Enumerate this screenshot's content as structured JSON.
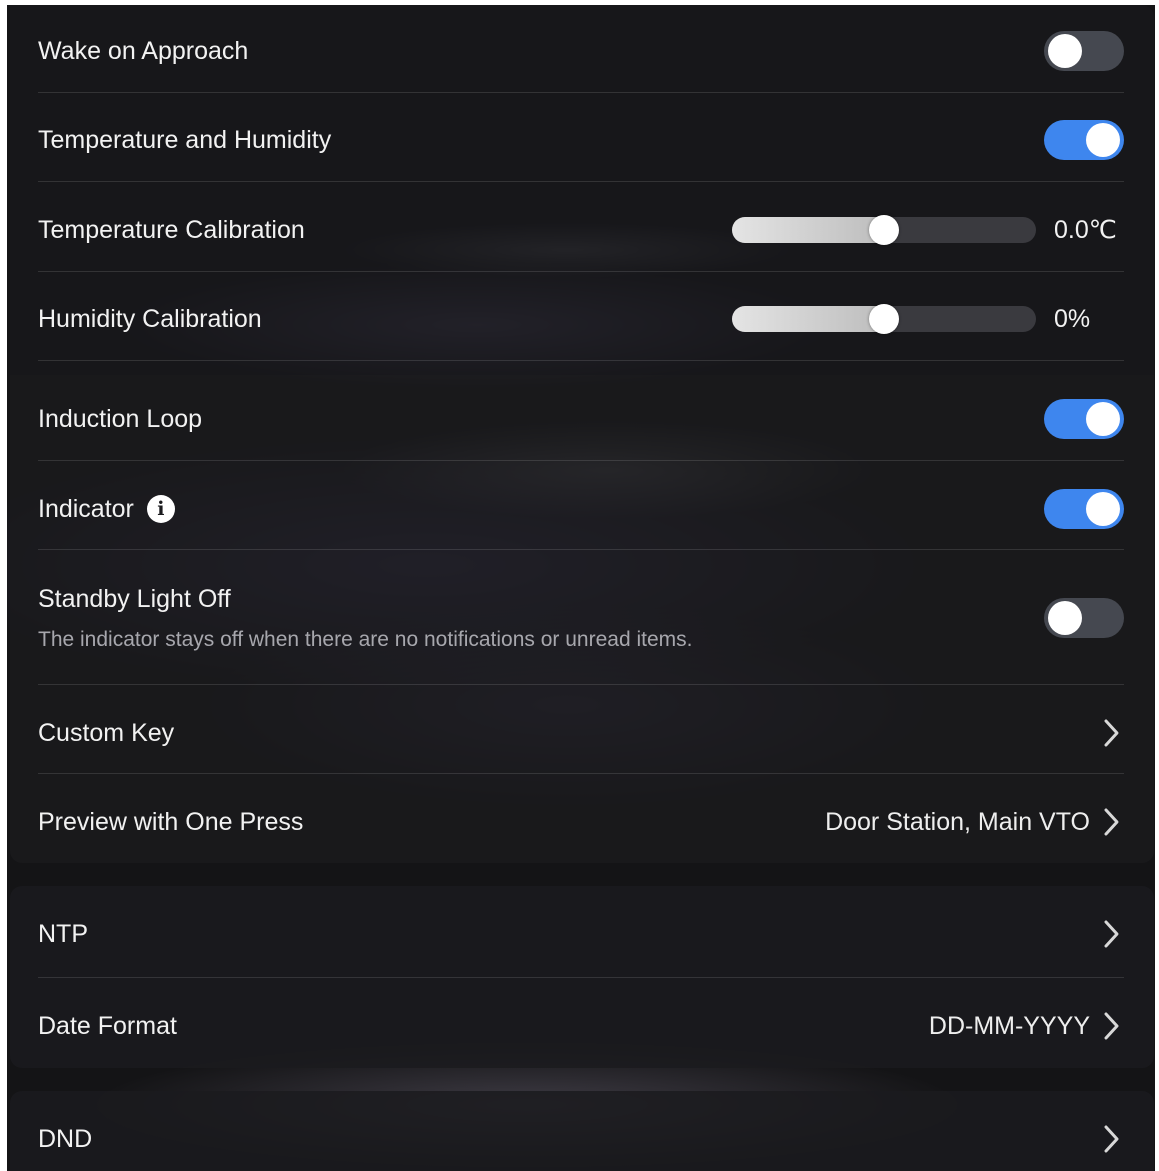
{
  "colors": {
    "accent": "#3e86ee",
    "toggle_off": "#454850",
    "background": "#141416"
  },
  "settings": {
    "wake_on_approach": {
      "label": "Wake on Approach",
      "enabled": false
    },
    "temp_humidity": {
      "label": "Temperature and Humidity",
      "enabled": true
    },
    "temp_calibration": {
      "label": "Temperature Calibration",
      "value": "0.0℃",
      "level": 0.5
    },
    "humidity_calibration": {
      "label": "Humidity Calibration",
      "value": "0%",
      "level": 0.5
    },
    "induction_loop": {
      "label": "Induction Loop",
      "enabled": true
    },
    "indicator": {
      "label": "Indicator",
      "enabled": true,
      "icon": "info-icon"
    },
    "standby_light_off": {
      "label": "Standby Light Off",
      "description": "The indicator stays off when there are no notifications or unread items.",
      "enabled": false
    },
    "custom_key": {
      "label": "Custom Key",
      "icon": "chevron-right-icon"
    },
    "preview_one_press": {
      "label": "Preview with One Press",
      "value": "Door Station, Main VTO",
      "icon": "chevron-right-icon"
    },
    "ntp": {
      "label": "NTP",
      "icon": "chevron-right-icon"
    },
    "date_format": {
      "label": "Date Format",
      "value": "DD-MM-YYYY",
      "icon": "chevron-right-icon"
    },
    "dnd": {
      "label": "DND",
      "icon": "chevron-right-icon"
    }
  }
}
